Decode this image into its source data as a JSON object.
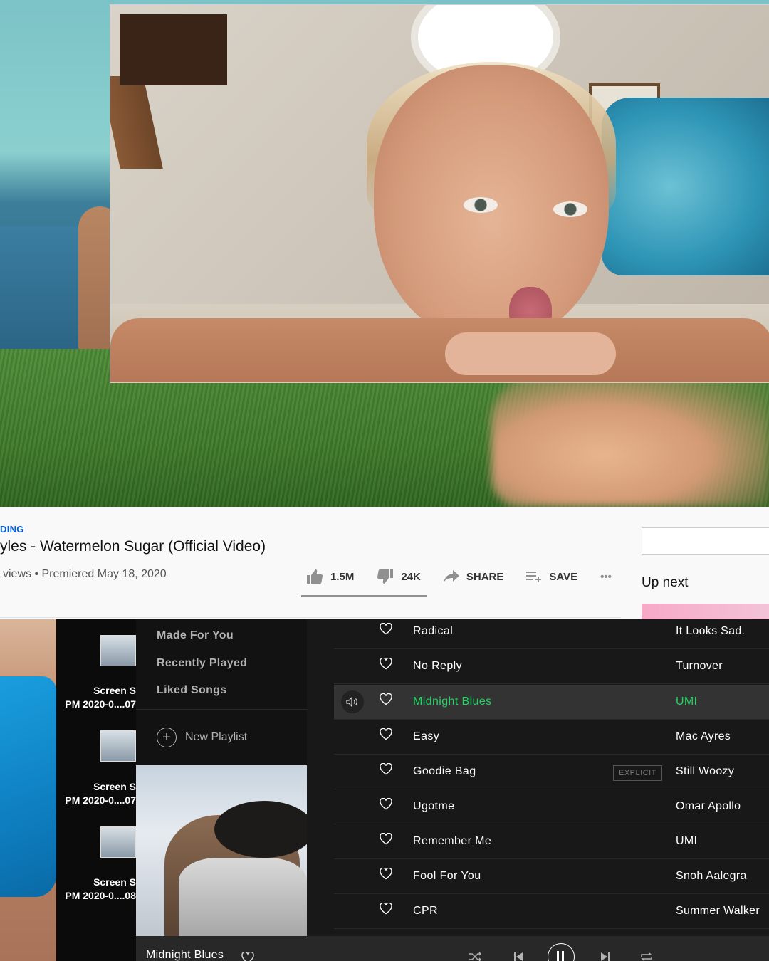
{
  "youtube": {
    "trending_label": "DING",
    "video_title": "yles - Watermelon Sugar (Official Video)",
    "meta": "views • Premiered May 18, 2020",
    "likes": "1.5M",
    "dislikes": "24K",
    "share_label": "SHARE",
    "save_label": "SAVE",
    "more_label": "•••",
    "up_next": "Up next",
    "search_placeholder": ""
  },
  "desktop": {
    "screenshots": [
      {
        "name": "Screen S",
        "date": "PM  2020-0....07"
      },
      {
        "name": "Screen S",
        "date": "PM  2020-0....07"
      },
      {
        "name": "Screen S",
        "date": "PM  2020-0....08"
      }
    ]
  },
  "spotify": {
    "nav": [
      "Made For You",
      "Recently Played",
      "Liked Songs"
    ],
    "new_playlist": "New Playlist",
    "tracks": [
      {
        "title": "Radical",
        "artist": "It Looks Sad.",
        "explicit": false,
        "playing": false
      },
      {
        "title": "No Reply",
        "artist": "Turnover",
        "explicit": false,
        "playing": false
      },
      {
        "title": "Midnight Blues",
        "artist": "UMI",
        "explicit": false,
        "playing": true
      },
      {
        "title": "Easy",
        "artist": "Mac Ayres",
        "explicit": false,
        "playing": false
      },
      {
        "title": "Goodie Bag",
        "artist": "Still Woozy",
        "explicit": true,
        "playing": false
      },
      {
        "title": "Ugotme",
        "artist": "Omar Apollo",
        "explicit": false,
        "playing": false
      },
      {
        "title": "Remember Me",
        "artist": "UMI",
        "explicit": false,
        "playing": false
      },
      {
        "title": "Fool For You",
        "artist": "Snoh Aalegra",
        "explicit": false,
        "playing": false
      },
      {
        "title": "CPR",
        "artist": "Summer Walker",
        "explicit": false,
        "playing": false
      }
    ],
    "explicit_label": "EXPLICIT",
    "now_playing": "Midnight Blues",
    "accent_color": "#1ed760",
    "icons": [
      "heart-icon",
      "speaker-icon",
      "shuffle-icon",
      "previous-icon",
      "pause-icon",
      "next-icon",
      "repeat-icon",
      "plus-icon"
    ]
  },
  "youtube_icons": [
    "thumbs-up-icon",
    "thumbs-down-icon",
    "share-icon",
    "save-playlist-icon",
    "more-icon"
  ]
}
